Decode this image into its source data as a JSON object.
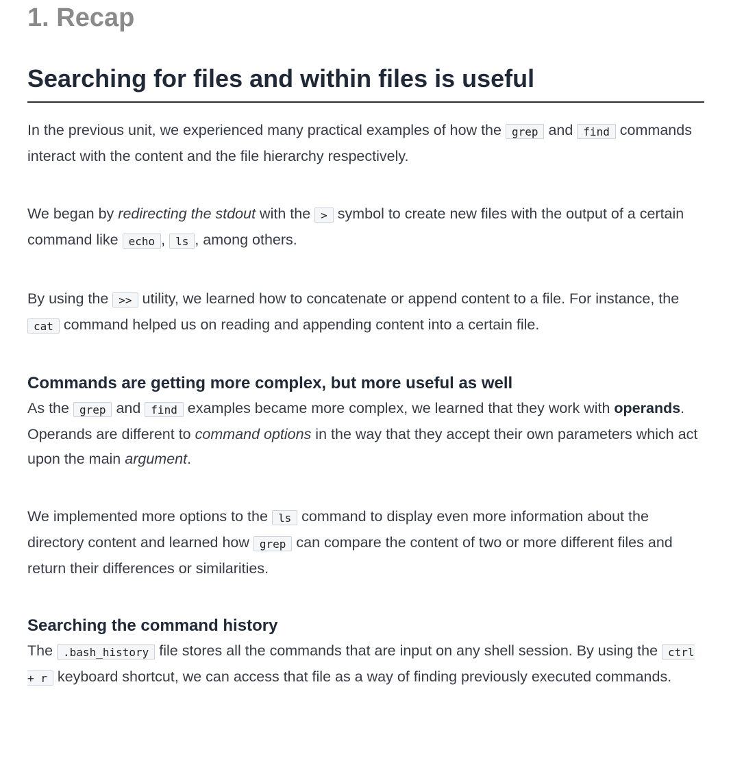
{
  "section": {
    "title": "1. Recap"
  },
  "heading": "Searching for files and within files is useful",
  "para1": {
    "t1": "In the previous unit, we experienced many practical examples of how the ",
    "c1": "grep",
    "t2": " and ",
    "c2": "find",
    "t3": " commands interact with the content and the file hierarchy respectively."
  },
  "para2": {
    "t1": "We began by ",
    "em1": "redirecting the stdout",
    "t2": " with the ",
    "c1": ">",
    "t3": " symbol to create new files with the output of a certain command like ",
    "c2": "echo",
    "t4": ", ",
    "c3": "ls",
    "t5": ", among others."
  },
  "para3": {
    "t1": "By using the ",
    "c1": ">>",
    "t2": " utility, we learned how to concatenate or append content to a file. For instance, the ",
    "c2": "cat",
    "t3": " command helped us on reading and appending content into a certain file."
  },
  "sub1": "Commands are getting more complex, but more useful as well",
  "para4": {
    "t1": "As the ",
    "c1": "grep",
    "t2": " and ",
    "c2": "find",
    "t3": " examples became more complex, we learned that they work with ",
    "strong1": "operands",
    "t4": ". Operands are different to ",
    "em1": "command options",
    "t5": " in the way that they accept their own parameters which act upon the main ",
    "em2": "argument",
    "t6": "."
  },
  "para5": {
    "t1": "We implemented more options to the ",
    "c1": "ls",
    "t2": " command to display even more information about the directory content and learned how ",
    "c2": "grep",
    "t3": " can compare the content of two or more different files and return their differences or similarities."
  },
  "sub2": "Searching the command history",
  "para6": {
    "t1": "The ",
    "c1": ".bash_history",
    "t2": " file stores all the commands that are input on any shell session. By using the ",
    "c2": "ctrl + r",
    "t3": " keyboard shortcut, we can access that file as a way of finding previously executed commands."
  }
}
